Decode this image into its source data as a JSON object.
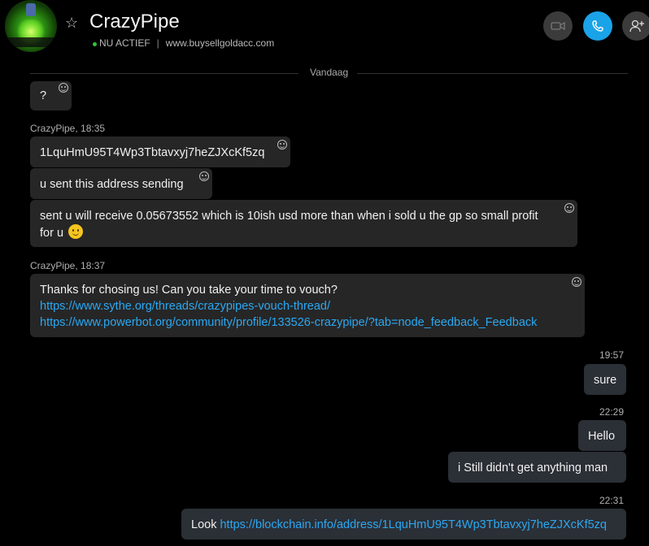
{
  "header": {
    "contact_name": "CrazyPipe",
    "status": "NU ACTIEF",
    "separator": "|",
    "website": "www.buysellgoldacc.com",
    "status_color": "#33c43a",
    "call_button_color": "#1aa3e8"
  },
  "divider": {
    "label": "Vandaag"
  },
  "messages": [
    {
      "text": "?"
    },
    {
      "sender": "CrazyPipe, 18:35"
    },
    {
      "text": "1LquHmU95T4Wp3Tbtavxyj7heZJXcKf5zq"
    },
    {
      "text": "u sent this address sending"
    },
    {
      "text": "sent u will receive 0.05673552 which is 10ish usd more than when i sold u the gp so small profit for u"
    },
    {
      "sender": "CrazyPipe, 18:37"
    },
    {
      "text": "Thanks for chosing us! Can you take your time to vouch?",
      "links": [
        "https://www.sythe.org/threads/crazypipes-vouch-thread/",
        "https://www.powerbot.org/community/profile/133526-crazypipe/?tab=node_feedback_Feedback"
      ]
    },
    {
      "time": "19:57"
    },
    {
      "text": "sure"
    },
    {
      "time": "22:29"
    },
    {
      "text": "Hello"
    },
    {
      "text": "i Still didn't get anything man"
    },
    {
      "time": "22:31"
    },
    {
      "text": "Look",
      "link": "https://blockchain.info/address/1LquHmU95T4Wp3Tbtavxyj7heZJXcKf5zq"
    }
  ]
}
